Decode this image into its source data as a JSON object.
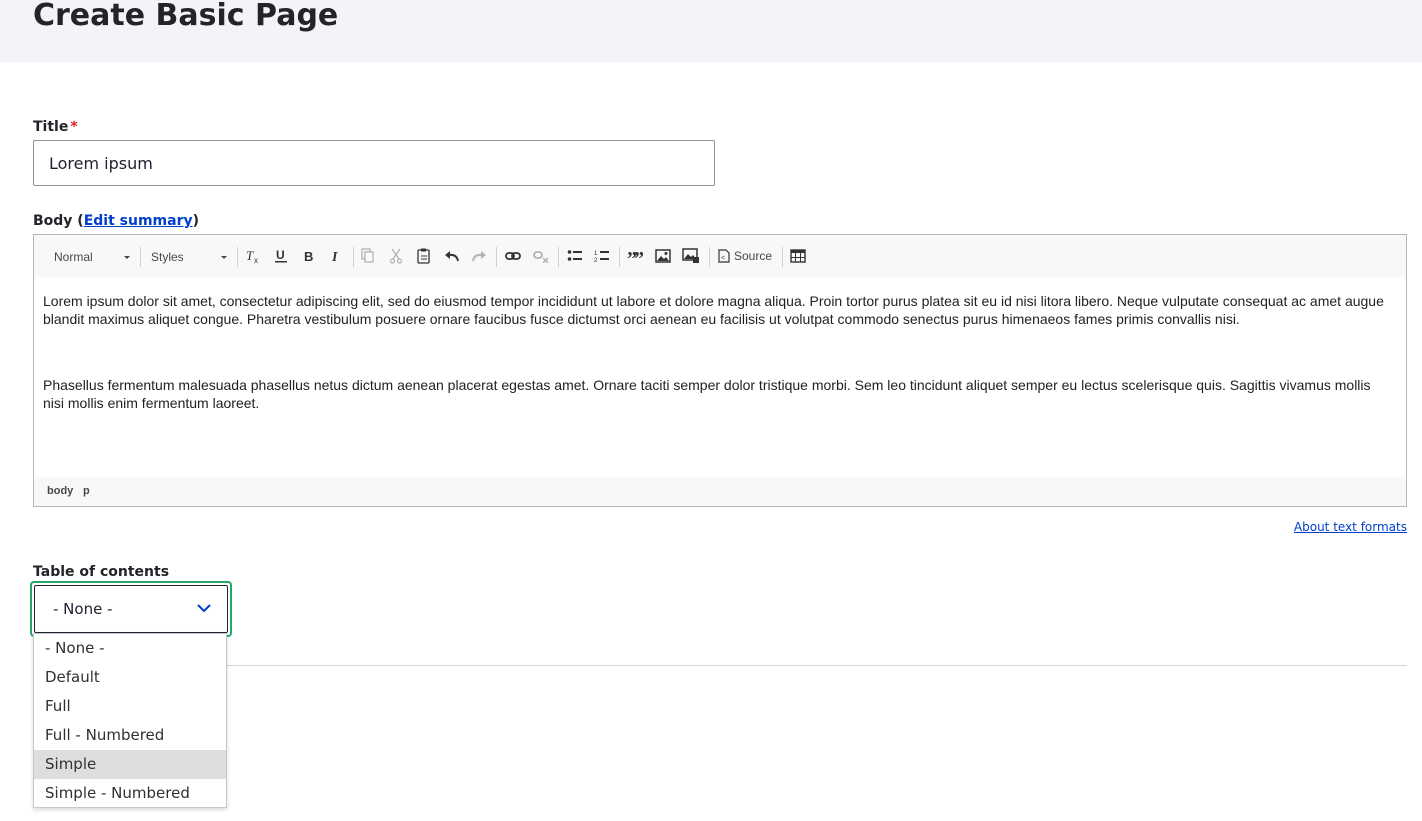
{
  "page": {
    "title": "Create Basic Page"
  },
  "title_field": {
    "label": "Title",
    "required_mark": "*",
    "value": "Lorem ipsum"
  },
  "body_field": {
    "label_prefix": "Body (",
    "edit_summary": "Edit summary",
    "label_suffix": ")"
  },
  "toolbar": {
    "format_combo": "Normal",
    "styles_combo": "Styles",
    "source_label": "Source",
    "icons": [
      "remove-format-icon",
      "underline-icon",
      "bold-icon",
      "italic-icon",
      "copy-icon",
      "cut-icon",
      "paste-icon",
      "undo-icon",
      "redo-icon",
      "link-icon",
      "unlink-icon",
      "bulleted-list-icon",
      "numbered-list-icon",
      "blockquote-icon",
      "image-icon",
      "media-icon",
      "source-icon",
      "table-icon"
    ]
  },
  "editor": {
    "paragraphs": [
      "Lorem ipsum dolor sit amet, consectetur adipiscing elit, sed do eiusmod tempor incididunt ut labore et dolore magna aliqua. Proin tortor purus platea sit eu id nisi litora libero. Neque vulputate consequat ac amet augue blandit maximus aliquet congue. Pharetra vestibulum posuere ornare faucibus fusce dictumst orci aenean eu facilisis ut volutpat commodo senectus purus himenaeos fames primis convallis nisi.",
      "Phasellus fermentum malesuada phasellus netus dictum aenean placerat egestas amet. Ornare taciti semper dolor tristique morbi. Sem leo tincidunt aliquet semper eu lectus scelerisque quis. Sagittis vivamus mollis nisi mollis enim fermentum laoreet."
    ],
    "path": [
      "body",
      "p"
    ]
  },
  "about_text_formats": "About text formats",
  "toc": {
    "label": "Table of contents",
    "selected": "- None -",
    "options": [
      "- None -",
      "Default",
      "Full",
      "Full - Numbered",
      "Simple",
      "Simple - Numbered"
    ],
    "hovered_option": "Simple"
  },
  "colors": {
    "focus_ring": "#26a769",
    "link": "#003ecc",
    "required": "#d72222"
  }
}
